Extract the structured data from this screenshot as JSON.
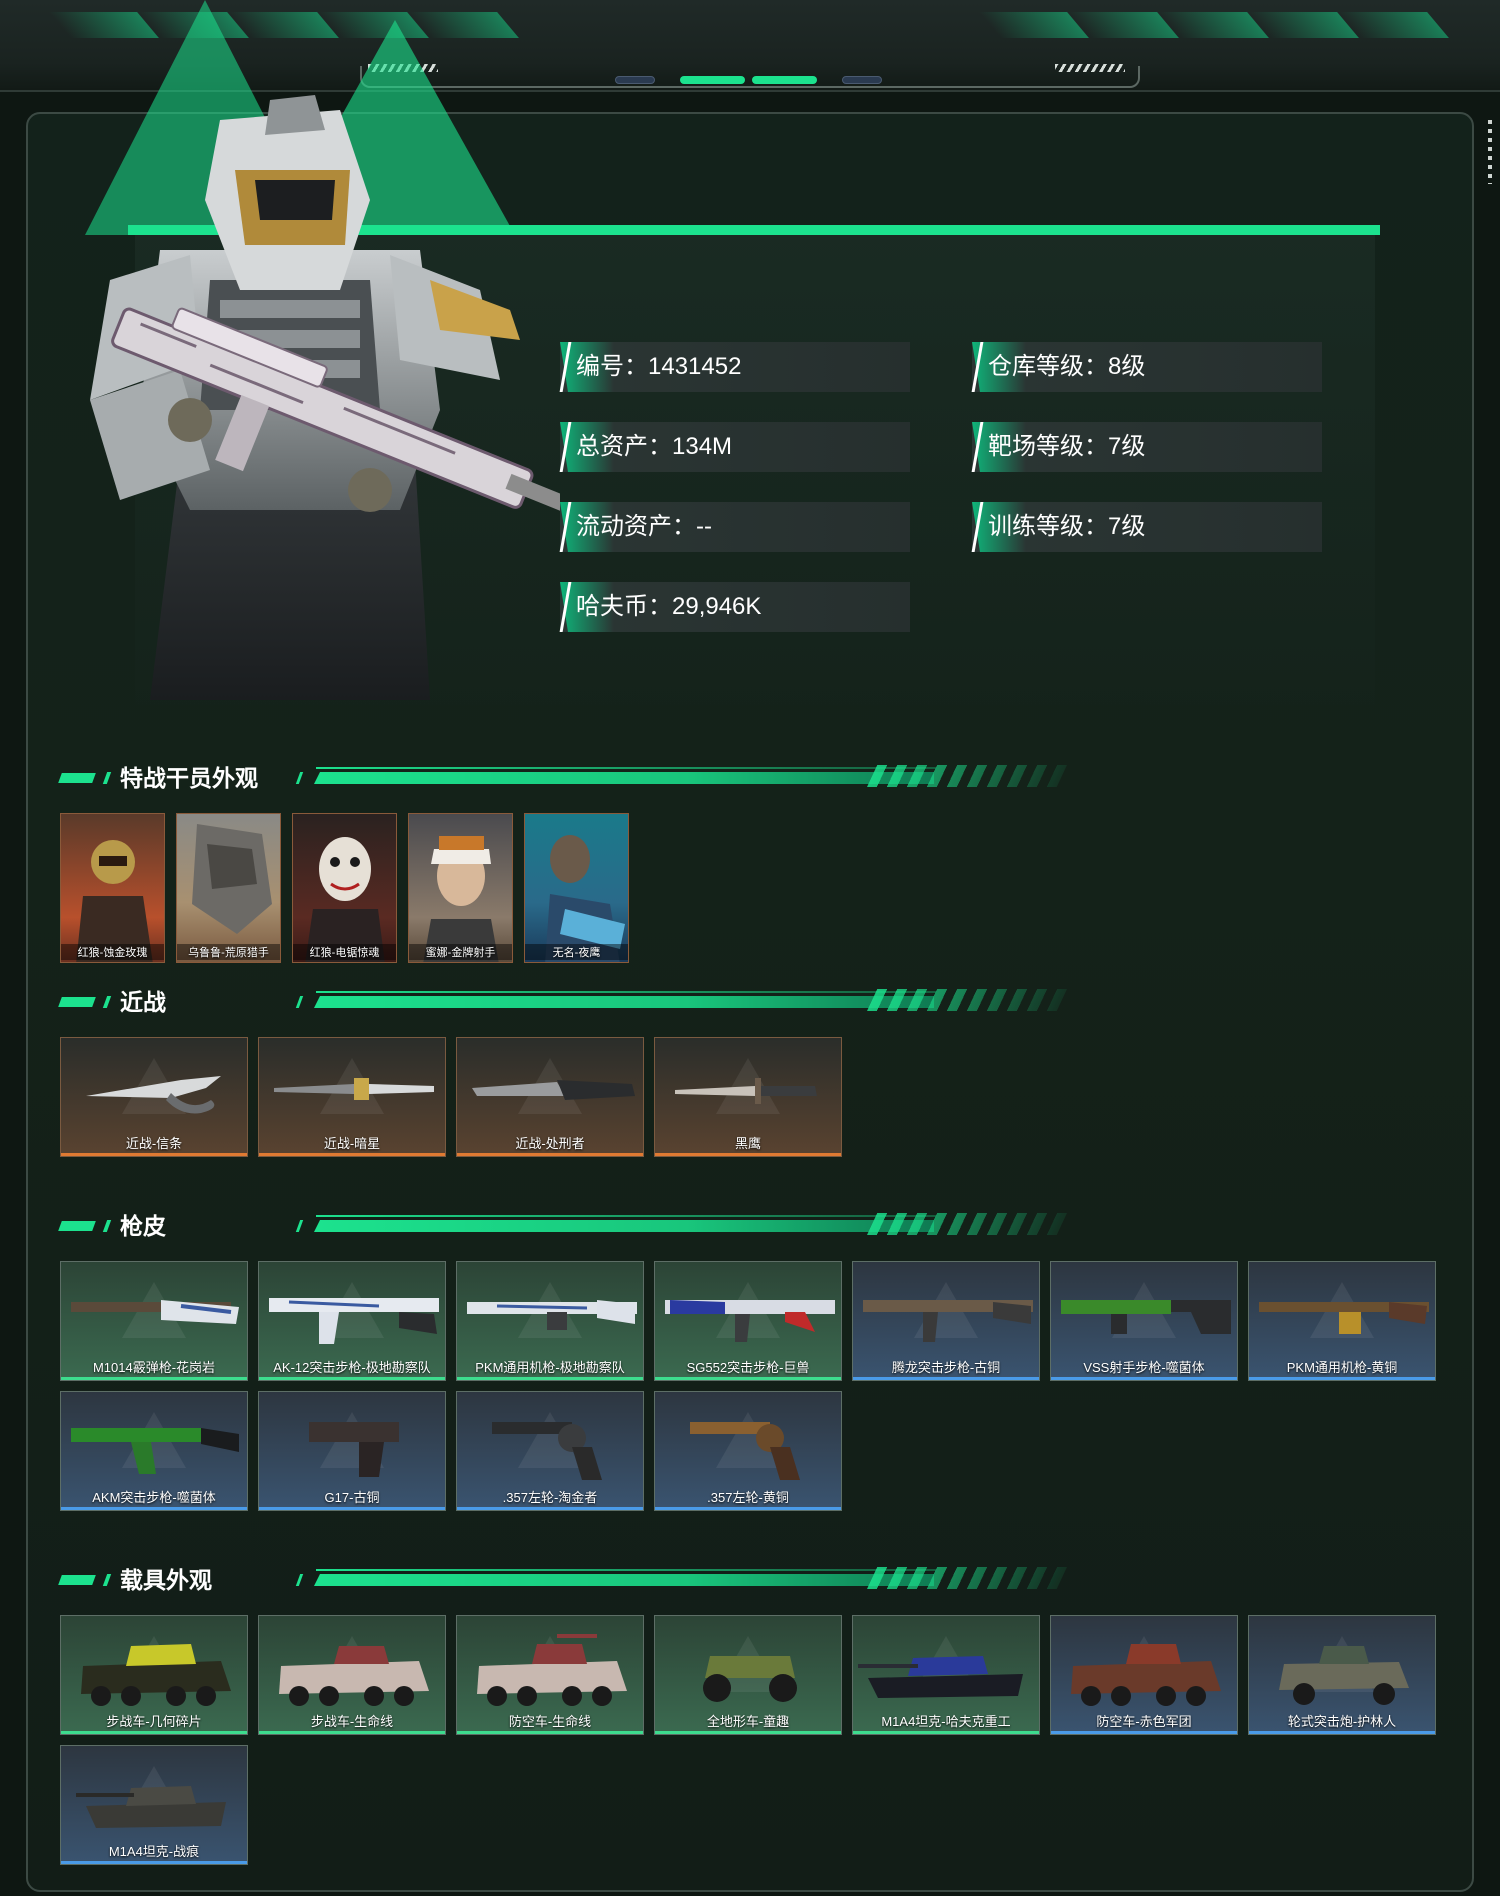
{
  "profile": {
    "stats": [
      {
        "label": "编号：",
        "value": "1431452"
      },
      {
        "label": "仓库等级：",
        "value": "8级"
      },
      {
        "label": "总资产：",
        "value": "134M"
      },
      {
        "label": "靶场等级：",
        "value": "7级"
      },
      {
        "label": "流动资产：",
        "value": "--"
      },
      {
        "label": "训练等级：",
        "value": "7级"
      },
      {
        "label": "哈夫币：",
        "value": "29,946K"
      }
    ]
  },
  "sections": {
    "agents": {
      "title": "特战干员外观",
      "items": [
        "红狼-蚀金玫瑰",
        "乌鲁鲁-荒原猎手",
        "红狼-电锯惊魂",
        "蜜娜-金牌射手",
        "无名-夜鹰"
      ]
    },
    "melee": {
      "title": "近战",
      "items": [
        "近战-信条",
        "近战-暗星",
        "近战-处刑者",
        "黑鹰"
      ]
    },
    "gun_skins": {
      "title": "枪皮",
      "items": [
        {
          "name": "M1014霰弹枪-花岗岩",
          "tier": "green"
        },
        {
          "name": "AK-12突击步枪-极地勘察队",
          "tier": "green"
        },
        {
          "name": "PKM通用机枪-极地勘察队",
          "tier": "green"
        },
        {
          "name": "SG552突击步枪-巨兽",
          "tier": "green"
        },
        {
          "name": "腾龙突击步枪-古铜",
          "tier": "blue"
        },
        {
          "name": "VSS射手步枪-噬菌体",
          "tier": "blue"
        },
        {
          "name": "PKM通用机枪-黄铜",
          "tier": "blue"
        },
        {
          "name": "AKM突击步枪-噬菌体",
          "tier": "blue"
        },
        {
          "name": "G17-古铜",
          "tier": "blue"
        },
        {
          "name": ".357左轮-淘金者",
          "tier": "blue"
        },
        {
          "name": ".357左轮-黄铜",
          "tier": "blue"
        }
      ]
    },
    "vehicles": {
      "title": "载具外观",
      "items": [
        {
          "name": "步战车-几何碎片",
          "tier": "green"
        },
        {
          "name": "步战车-生命线",
          "tier": "green"
        },
        {
          "name": "防空车-生命线",
          "tier": "green"
        },
        {
          "name": "全地形车-童趣",
          "tier": "green"
        },
        {
          "name": "M1A4坦克-哈夫克重工",
          "tier": "green"
        },
        {
          "name": "防空车-赤色军团",
          "tier": "blue"
        },
        {
          "name": "轮式突击炮-护林人",
          "tier": "blue"
        },
        {
          "name": "M1A4坦克-战痕",
          "tier": "blue"
        }
      ]
    }
  }
}
